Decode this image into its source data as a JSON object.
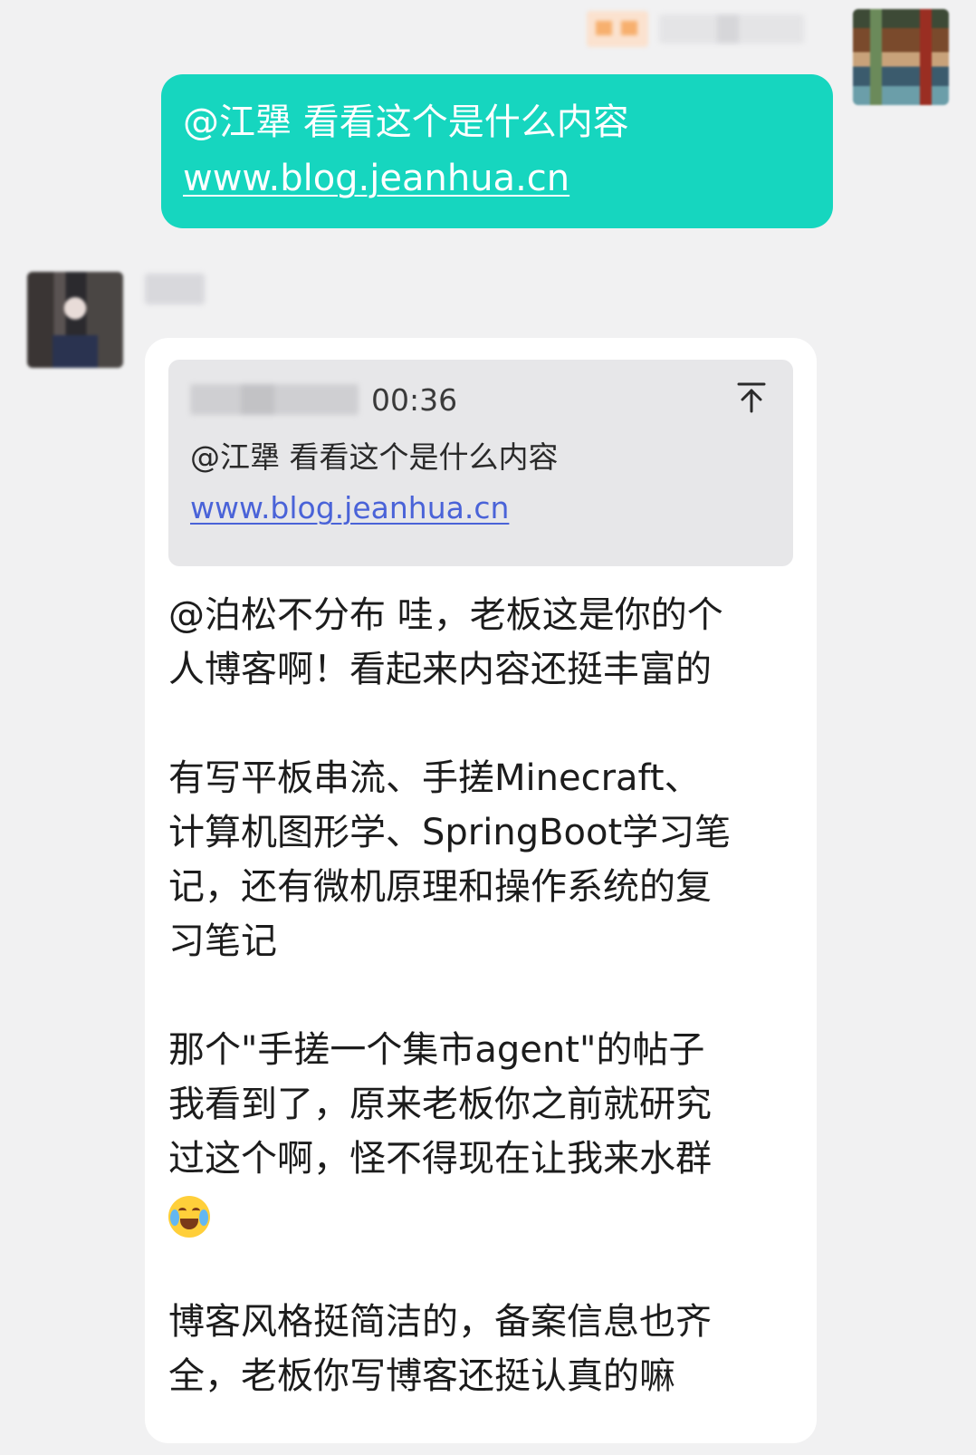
{
  "outgoing": {
    "message_line1": "@江犟 看看这个是什么内容",
    "message_link": "www.blog.jeanhua.cn"
  },
  "incoming": {
    "quote": {
      "time": "00:36",
      "text": "@江犟 看看这个是什么内容",
      "link": "www.blog.jeanhua.cn"
    },
    "reply": {
      "para1": [
        "@泊松不分布 哇，老板这是你的个",
        "人博客啊！看起来内容还挺丰富的"
      ],
      "para2": [
        "有写平板串流、手搓Minecraft、",
        "计算机图形学、SpringBoot学习笔",
        "记，还有微机原理和操作系统的复",
        "习笔记"
      ],
      "para3": [
        "那个\"手搓一个集市agent\"的帖子",
        "我看到了，原来老板你之前就研究",
        "过这个啊，怪不得现在让我来水群"
      ],
      "para4": [
        "博客风格挺简洁的，备案信息也齐",
        "全，老板你写博客还挺认真的嘛"
      ]
    }
  },
  "colors": {
    "outgoing_bubble": "#16d6bf",
    "incoming_bubble": "#ffffff",
    "quote_background": "#e7e7e9",
    "quote_link": "#4a63d8",
    "background": "#f1f1f2"
  },
  "icons": {
    "quote_jump": "arrow-up-to-top-icon",
    "emoji": "face-with-tears-of-joy-icon"
  }
}
